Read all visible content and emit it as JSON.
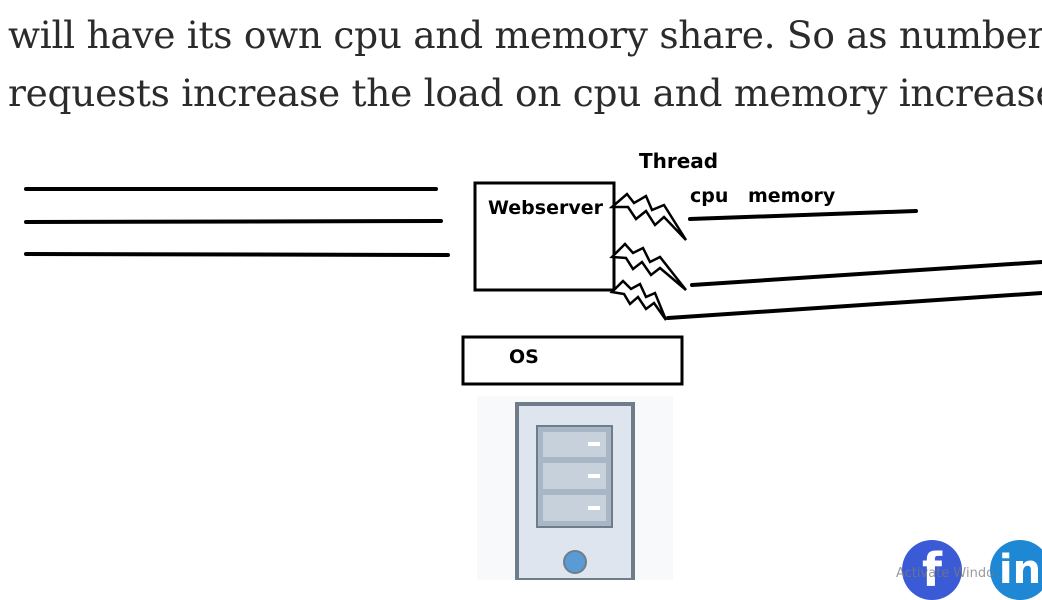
{
  "article": {
    "line1": "will have its own cpu and memory share. So as number of",
    "line2": "requests increase the load on cpu and memory increases."
  },
  "diagram": {
    "thread_label": "Thread",
    "cpu_label": "cpu",
    "memory_label": "memory",
    "webserver_label": "Webserver",
    "os_label": "OS"
  },
  "social": {
    "facebook_glyph": "f",
    "linkedin_glyph": "in"
  },
  "watermark": {
    "text": "Activate Windo"
  },
  "colors": {
    "text": "#2b2b2b",
    "facebook": "#3b5bd6",
    "linkedin": "#1e88d4",
    "server_case": "#6f7d8a",
    "server_body": "#dfe5ee",
    "server_light": "#5b9bd5"
  },
  "icons": [
    "lightning-bolt-icon",
    "server-tower-icon",
    "facebook-icon",
    "linkedin-icon"
  ]
}
